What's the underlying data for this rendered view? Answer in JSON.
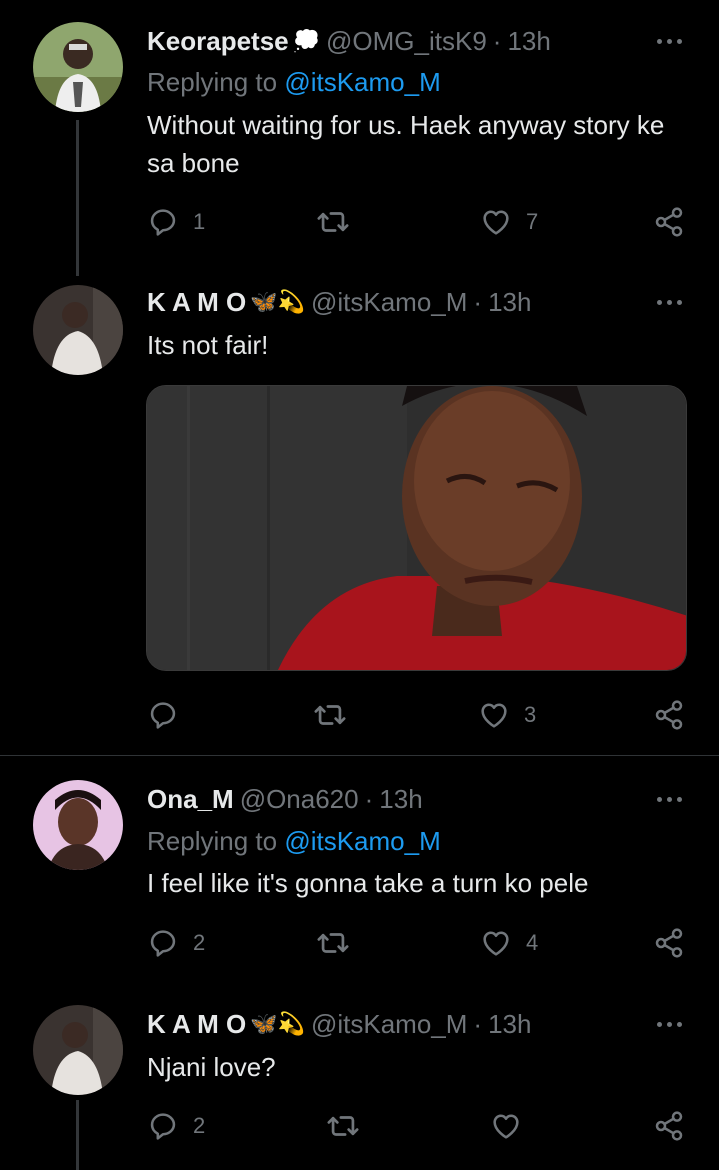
{
  "tweets": [
    {
      "name": "Keorapetse",
      "emoji": "💭",
      "handle": "@OMG_itsK9",
      "separator": "·",
      "time": "13h",
      "replying_label": "Replying to",
      "replying_to": "@itsKamo_M",
      "text": "Without waiting for us. Haek anyway story ke sa bone",
      "replies": "1",
      "retweets": "",
      "likes": "7"
    },
    {
      "name": "K A M O",
      "emoji": "🦋💫",
      "handle": "@itsKamo_M",
      "separator": "·",
      "time": "13h",
      "text": "Its not fair!",
      "replies": "",
      "retweets": "",
      "likes": "3"
    },
    {
      "name": "Ona_M",
      "handle": "@Ona620",
      "separator": "·",
      "time": "13h",
      "replying_label": "Replying to",
      "replying_to": "@itsKamo_M",
      "text": "I feel like it's gonna take a turn ko pele",
      "replies": "2",
      "retweets": "",
      "likes": "4"
    },
    {
      "name": "K A M O",
      "emoji": "🦋💫",
      "handle": "@itsKamo_M",
      "separator": "·",
      "time": "13h",
      "text": "Njani love?",
      "replies": "2",
      "retweets": "",
      "likes": ""
    }
  ],
  "colors": {
    "background": "#000000",
    "text": "#e7e9ea",
    "muted": "#71767b",
    "link": "#1d9bf0",
    "thread_line": "#333639"
  },
  "icons": [
    "reply-icon",
    "retweet-icon",
    "like-icon",
    "share-icon",
    "more-icon"
  ]
}
